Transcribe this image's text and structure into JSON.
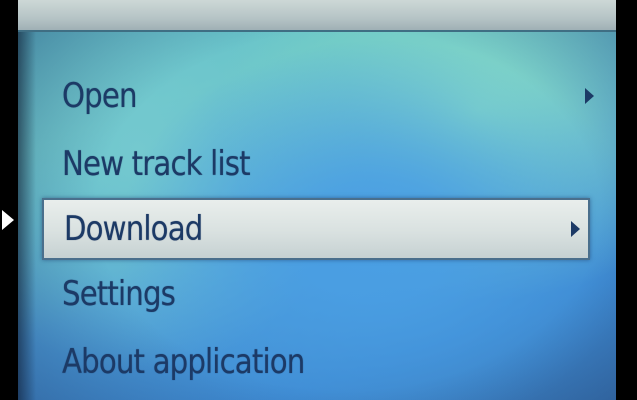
{
  "menu": {
    "items": [
      {
        "label": "Open",
        "has_submenu": true,
        "selected": false
      },
      {
        "label": "New track list",
        "has_submenu": false,
        "selected": false
      },
      {
        "label": "Download",
        "has_submenu": true,
        "selected": true
      },
      {
        "label": "Settings",
        "has_submenu": false,
        "selected": false
      },
      {
        "label": "About application",
        "has_submenu": false,
        "selected": false
      }
    ]
  },
  "icons": {
    "submenu": "chevron-right-icon",
    "pointer": "arrow-right-icon"
  },
  "colors": {
    "text": "#1c3a66",
    "highlight": "#e3e9e8",
    "screen_blue": "#4a9fe4",
    "screen_teal": "#86dbc6"
  }
}
